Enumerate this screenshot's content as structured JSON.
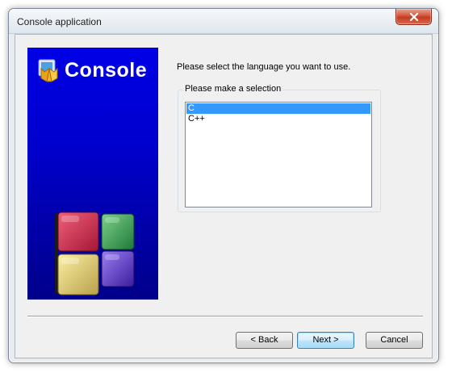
{
  "window": {
    "title": "Console application"
  },
  "banner": {
    "title": "Console"
  },
  "prompt": "Please select the language you want to use.",
  "selection_group": {
    "label": "Please make a selection",
    "options": [
      "C",
      "C++"
    ],
    "selected": "C"
  },
  "buttons": {
    "back": "< Back",
    "next": "Next >",
    "cancel": "Cancel"
  },
  "colors": {
    "banner_top": "#0000e6",
    "banner_bottom": "#00008a",
    "selection": "#3399ff",
    "close_button": "#c9452c"
  }
}
